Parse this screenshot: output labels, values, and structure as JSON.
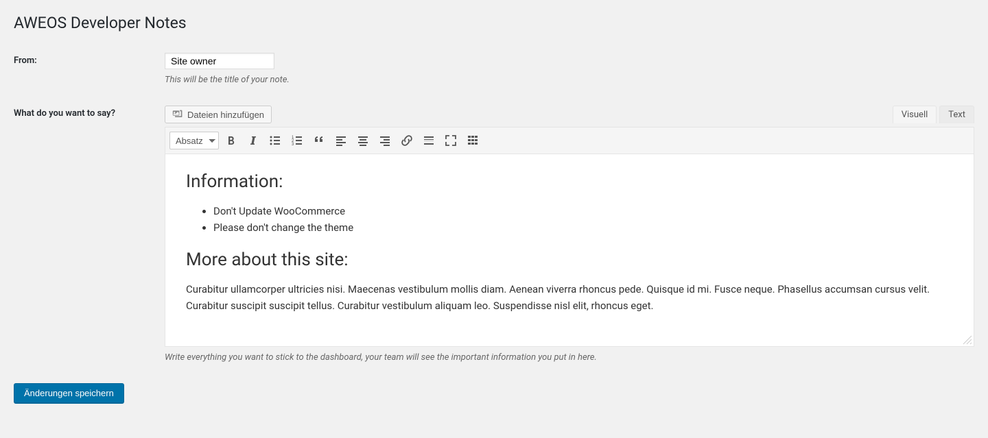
{
  "page": {
    "title": "AWEOS Developer Notes"
  },
  "from": {
    "label": "From:",
    "value": "Site owner",
    "helper": "This will be the title of your note."
  },
  "body": {
    "label": "What do you want to say?",
    "media_button": "Dateien hinzufügen",
    "tabs": {
      "visual": "Visuell",
      "text": "Text"
    },
    "format_select": "Absatz",
    "content": {
      "h1": "Information:",
      "li1": "Don't Update WooCommerce",
      "li2": "Please don't change the theme",
      "h2": "More about this site:",
      "p": "Curabitur ullamcorper ultricies nisi. Maecenas vestibulum mollis diam. Aenean viverra rhoncus pede. Quisque id mi. Fusce neque. Phasellus accumsan cursus velit. Curabitur suscipit suscipit tellus. Curabitur vestibulum aliquam leo. Suspendisse nisl elit, rhoncus eget."
    },
    "helper": "Write everything you want to stick to the dashboard, your team will see the important information you put in here."
  },
  "submit": {
    "label": "Änderungen speichern"
  }
}
